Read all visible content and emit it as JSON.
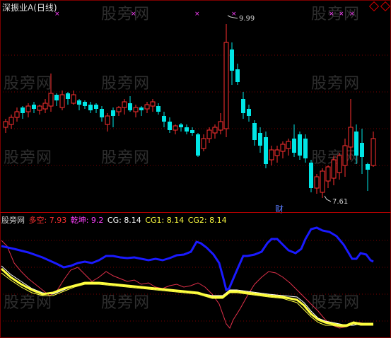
{
  "title": "深振业A(日线)",
  "high_label": "9.99",
  "low_label": "7.61",
  "cai_label": "财",
  "legend": {
    "prefix": "股旁网",
    "duokong": "多空: 7.93",
    "qiankun": "乾坤: 9.2",
    "cg": "CG: 8.14",
    "cg1": "CG1: 8.14",
    "cg2": "CG2: 8.14"
  },
  "watermark": "股旁网",
  "colors": {
    "up": "#ff3030",
    "down": "#00e6e6",
    "blue_line": "#1a1aff",
    "yellow_line": "#ffff40",
    "red_line": "#e0304a",
    "white_line": "#ffffff",
    "marker": "#ff40ff"
  },
  "chart_data": {
    "type": "candlestick",
    "price_range": [
      7.4,
      10.1
    ],
    "high": 9.99,
    "low": 7.61
  }
}
